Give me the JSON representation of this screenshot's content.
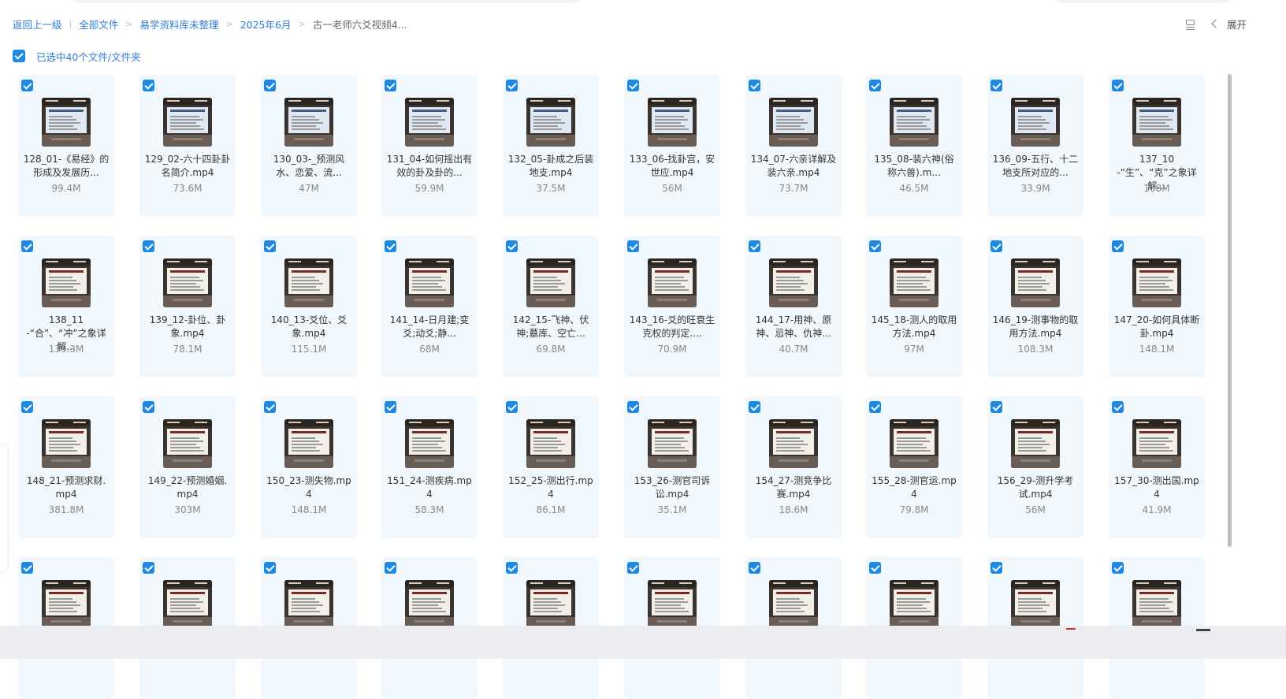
{
  "breadcrumb": {
    "back": "返回上一级",
    "items": [
      "全部文件",
      "易学资料库未整理",
      "2025年6月",
      "古一老师六爻视频4..."
    ]
  },
  "toolbar": {
    "expand": "展开"
  },
  "selection": {
    "label": "已选中40个文件/文件夹"
  },
  "files": [
    {
      "name": "128_01-《易经》的形成及发展历...",
      "size": "99.4M"
    },
    {
      "name": "129_02-六十四卦卦名简介.mp4",
      "size": "73.6M"
    },
    {
      "name": "130_03-_预测风水、恋爱、流...",
      "size": "47M"
    },
    {
      "name": "131_04-如何摇出有效的卦及卦的...",
      "size": "59.9M"
    },
    {
      "name": "132_05-卦成之后装地支.mp4",
      "size": "37.5M"
    },
    {
      "name": "133_06-找卦宫，安世应.mp4",
      "size": "56M"
    },
    {
      "name": "134_07-六亲详解及装六亲.mp4",
      "size": "73.7M"
    },
    {
      "name": "135_08-装六神(俗称六兽).m...",
      "size": "46.5M"
    },
    {
      "name": "136_09-五行、十二地支所对应的...",
      "size": "33.9M"
    },
    {
      "name": "137_10-“生”、“克”之象详解...",
      "size": "108M"
    },
    {
      "name": "138_11-“合”、“冲”之象详解...",
      "size": "139.3M"
    },
    {
      "name": "139_12-卦位、卦象.mp4",
      "size": "78.1M"
    },
    {
      "name": "140_13-爻位、爻象.mp4",
      "size": "115.1M"
    },
    {
      "name": "141_14-日月建;变爻;动爻;静...",
      "size": "68M"
    },
    {
      "name": "142_15-飞神、伏神;墓库、空亡...",
      "size": "69.8M"
    },
    {
      "name": "143_16-爻的旺衰生克权的判定....",
      "size": "70.9M"
    },
    {
      "name": "144_17-用神、原神、忌神、仇神...",
      "size": "40.7M"
    },
    {
      "name": "145_18-测人的取用方法.mp4",
      "size": "97M"
    },
    {
      "name": "146_19-测事物的取用方法.mp4",
      "size": "108.3M"
    },
    {
      "name": "147_20-如何具体断卦.mp4",
      "size": "148.1M"
    },
    {
      "name": "148_21-预测求财.mp4",
      "size": "381.8M"
    },
    {
      "name": "149_22-预测婚姻.mp4",
      "size": "303M"
    },
    {
      "name": "150_23-测失物.mp4",
      "size": "148.1M"
    },
    {
      "name": "151_24-测疾病.mp4",
      "size": "58.3M"
    },
    {
      "name": "152_25-测出行.mp4",
      "size": "86.1M"
    },
    {
      "name": "153_26-测官司诉讼.mp4",
      "size": "35.1M"
    },
    {
      "name": "154_27-测竞争比赛.mp4",
      "size": "18.6M"
    },
    {
      "name": "155_28-测官运.mp4",
      "size": "79.8M"
    },
    {
      "name": "156_29-测升学考试.mp4",
      "size": "56M"
    },
    {
      "name": "157_30-测出国.mp4",
      "size": "41.9M"
    },
    {
      "name": "",
      "size": ""
    },
    {
      "name": "",
      "size": ""
    },
    {
      "name": "",
      "size": ""
    },
    {
      "name": "",
      "size": ""
    },
    {
      "name": "",
      "size": ""
    },
    {
      "name": "",
      "size": ""
    },
    {
      "name": "",
      "size": ""
    },
    {
      "name": "",
      "size": ""
    },
    {
      "name": "",
      "size": ""
    },
    {
      "name": "",
      "size": ""
    }
  ]
}
